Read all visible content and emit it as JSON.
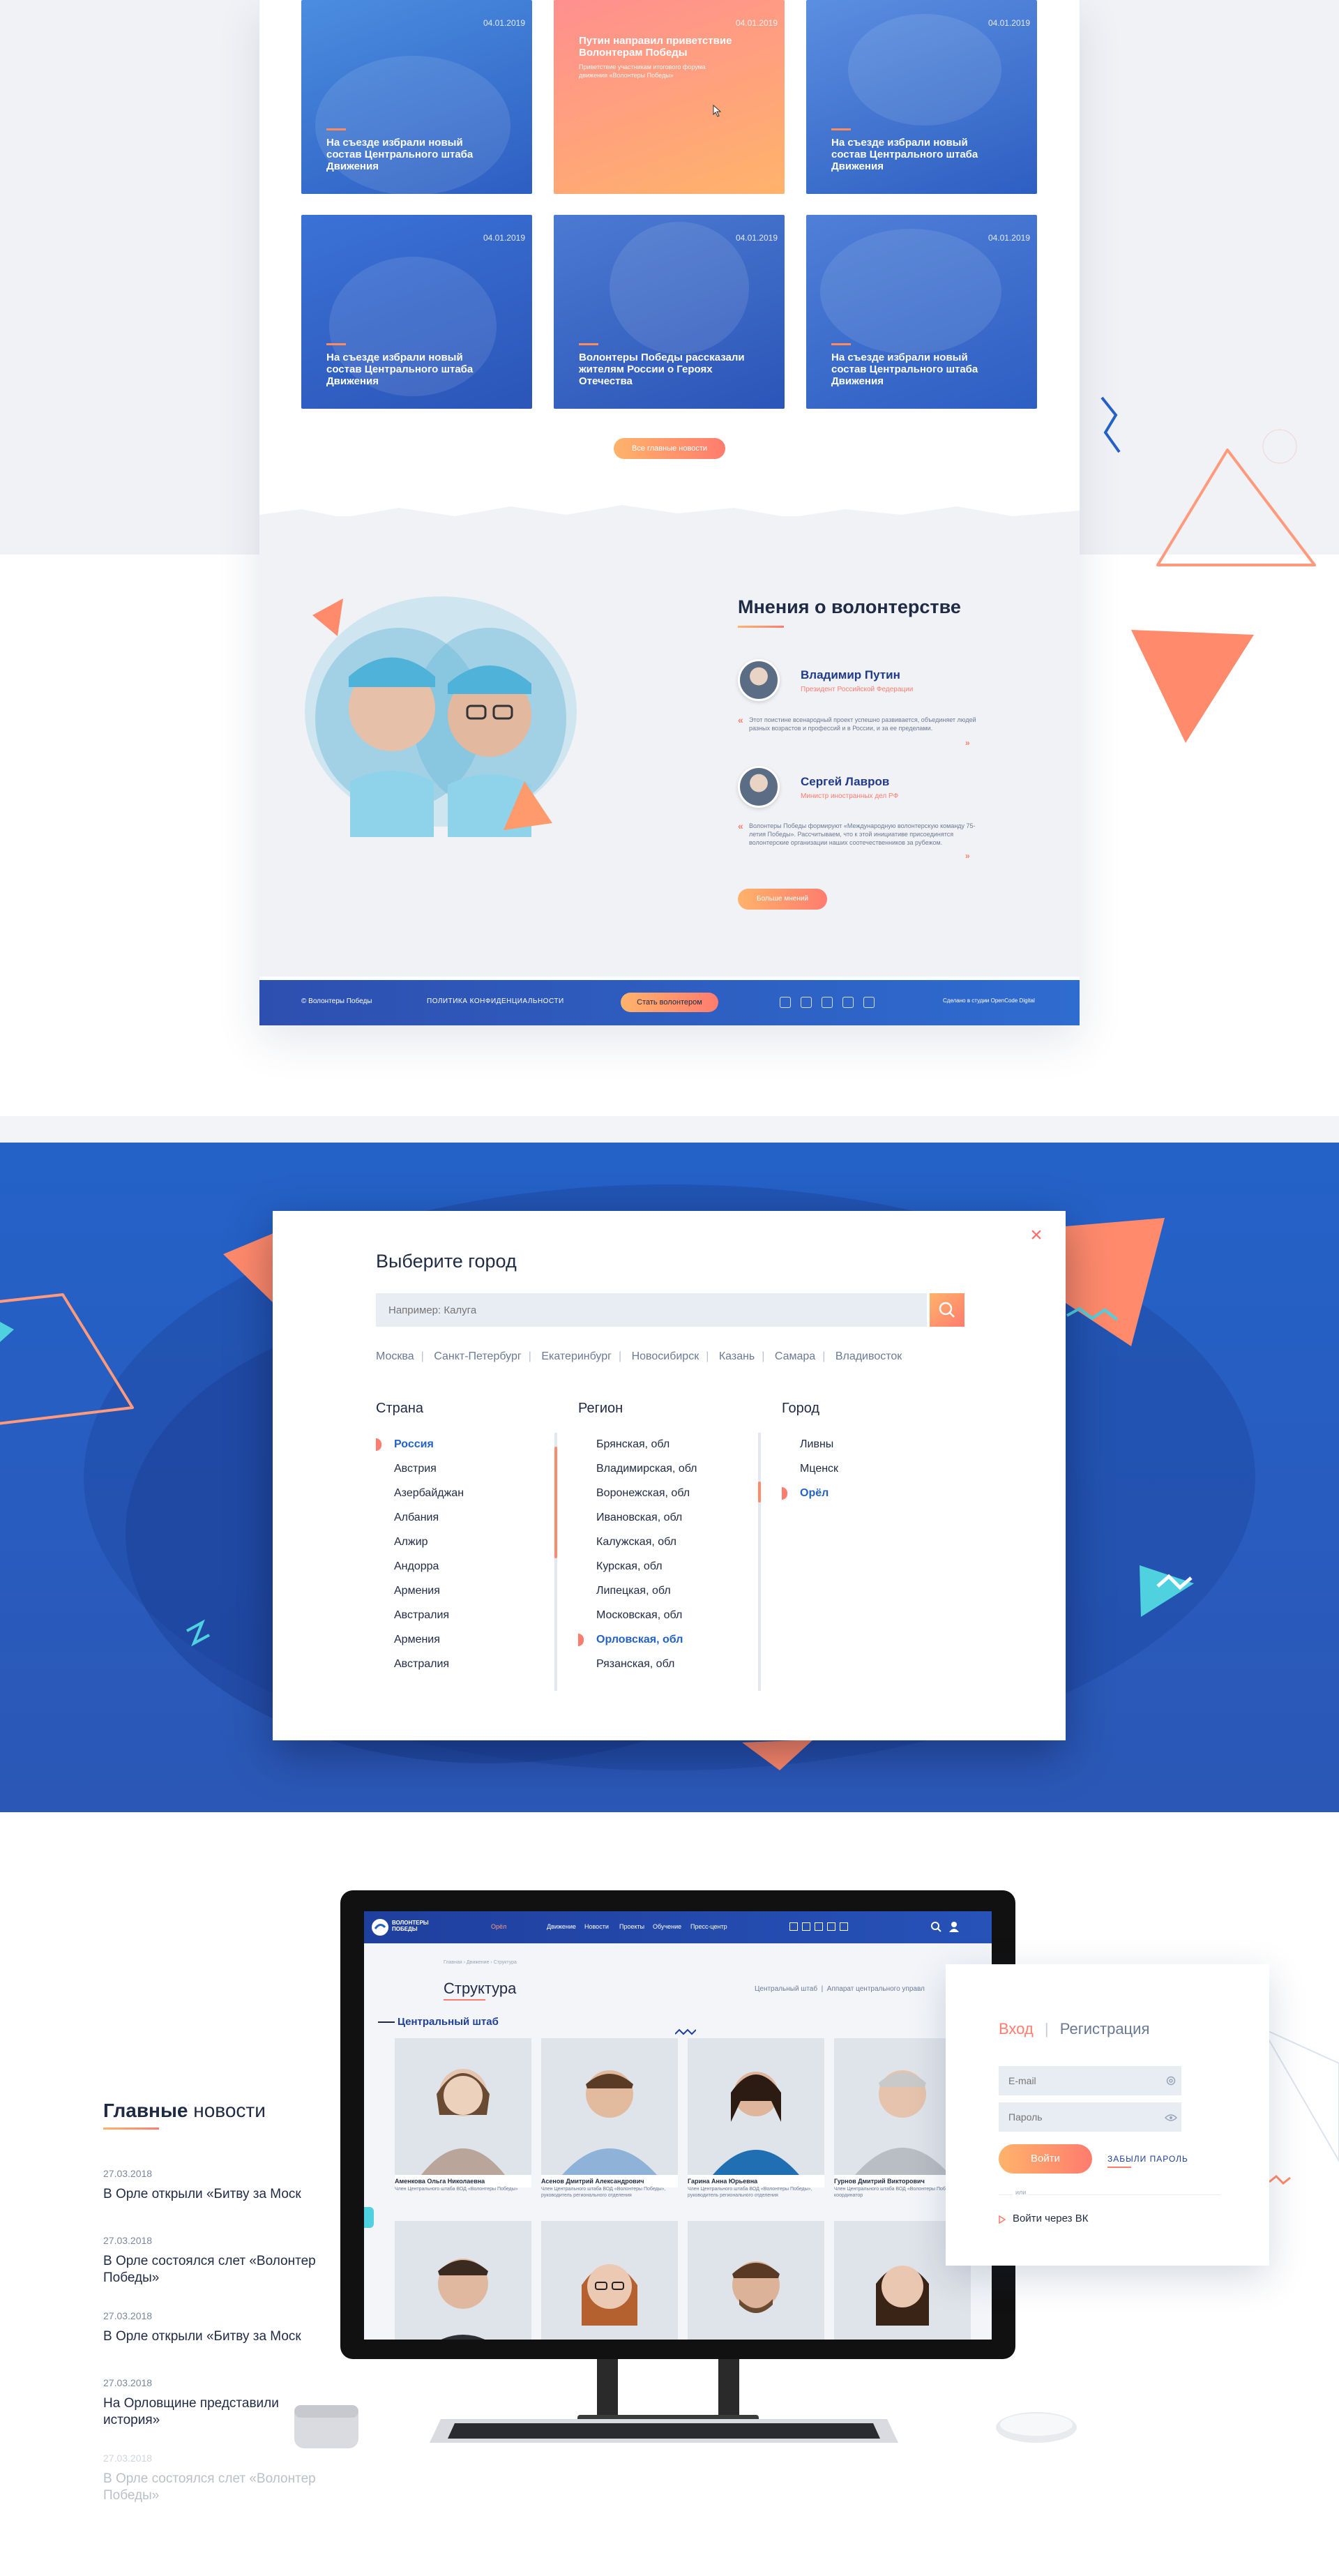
{
  "colors": {
    "accent_orange": "#ff7c6e",
    "accent_peach": "#ffb36b",
    "brand_blue": "#2462c8",
    "dark_text": "#1f2a44"
  },
  "news_cards": [
    {
      "date": "04.01.2019",
      "title": "На съезде избрали новый состав Центрального штаба Движения",
      "text": ""
    },
    {
      "date": "04.01.2019",
      "title": "Путин направил приветствие Волонтерам Победы",
      "text": "Приветствие участникам итогового форума движения «Волонтеры Победы»"
    },
    {
      "date": "04.01.2019",
      "title": "На съезде избрали новый состав Центрального штаба Движения",
      "text": ""
    },
    {
      "date": "04.01.2019",
      "title": "На съезде избрали новый состав Центрального штаба Движения",
      "text": ""
    },
    {
      "date": "04.01.2019",
      "title": "Волонтеры Победы рассказали жителям России о Героях Отечества",
      "text": ""
    },
    {
      "date": "04.01.2019",
      "title": "На съезде избрали новый состав Центрального штаба Движения",
      "text": ""
    }
  ],
  "all_news_label": "Все главные новости",
  "opinions": {
    "title": "Мнения о волонтерстве",
    "items": [
      {
        "name": "Владимир Путин",
        "role": "Президент Российской Федерации",
        "quote": "Этот поистине всенародный проект успешно развивается, объединяет людей разных возрастов и профессий и в России, и за ее пределами."
      },
      {
        "name": "Сергей Лавров",
        "role": "Министр иностранных дел РФ",
        "quote": "Волонтеры Победы формируют «Международную волонтерскую команду 75-летия Победы». Рассчитываем, что к этой инициативе присоединятся волонтерские организации наших соотечественников за рубежом."
      }
    ],
    "more_label": "Больше мнений"
  },
  "footer": {
    "copyright": "© Волонтеры Победы",
    "privacy": "ПОЛИТИКА КОНФИДЕНЦИАЛЬНОСТИ",
    "become_label": "Стать волонтером",
    "made_by": "Сделано в студии OpenCode Digital",
    "social_icons": [
      "vk-icon",
      "youtube-icon",
      "ok-icon",
      "facebook-icon",
      "instagram-icon"
    ]
  },
  "city_modal": {
    "title": "Выберите город",
    "search_placeholder": "Например: Калуга",
    "quick_cities": [
      "Москва",
      "Санкт-Петербург",
      "Екатеринбург",
      "Новосибирск",
      "Казань",
      "Самара",
      "Владивосток"
    ],
    "country_header": "Страна",
    "region_header": "Регион",
    "city_header": "Город",
    "countries": [
      "Россия",
      "Австрия",
      "Азербайджан",
      "Албания",
      "Алжир",
      "Андорра",
      "Армения",
      "Австралия",
      "Армения",
      "Австралия"
    ],
    "selected_country": "Россия",
    "regions": [
      "Брянская, обл",
      "Владимирская, обл",
      "Воронежская, обл",
      "Ивановская, обл",
      "Калужская, обл",
      "Курская, обл",
      "Липецкая, обл",
      "Московская, обл",
      "Орловская, обл",
      "Рязанская, обл"
    ],
    "selected_region": "Орловская, обл",
    "cities": [
      "Ливны",
      "Мценск",
      "Орёл"
    ],
    "selected_city": "Орёл"
  },
  "main_news": {
    "title_bold": "Главные",
    "title_rest": " новости",
    "items": [
      {
        "date": "27.03.2018",
        "title": "В Орле открыли «Битву за Моск"
      },
      {
        "date": "27.03.2018",
        "title": "В Орле состоялся слет «Волонтер Победы»"
      },
      {
        "date": "27.03.2018",
        "title": "В Орле открыли «Битву за Моск"
      },
      {
        "date": "27.03.2018",
        "title": "На Орловщине представили история»"
      },
      {
        "date": "27.03.2018",
        "title": "В Орле состоялся слет «Волонтер Победы»"
      }
    ]
  },
  "monitor_site": {
    "logo_text": "ВОЛОНТЕРЫ ПОБЕДЫ",
    "city": "Орёл",
    "nav": [
      "Движение",
      "Новости",
      "Проекты",
      "Обучение",
      "Пресс-центр"
    ],
    "breadcrumb": "Главная › Движение › Структура",
    "title": "Структура",
    "crumbs_right": "Центральный штаб  |  Аппарат центрального управл",
    "subtitle": "Центральный штаб",
    "people": [
      {
        "name": "Аменкова Ольга Николаевна",
        "role": "Член Центрального штаба ВОД «Волонтеры Победы»"
      },
      {
        "name": "Асенов Дмитрий Александрович",
        "role": "Член Центрального штаба ВОД «Волонтеры Победы», руководитель регионального отделения"
      },
      {
        "name": "Гарина Анна Юрьевна",
        "role": "Член Центрального штаба ВОД «Волонтеры Победы», руководитель регионального отделения"
      },
      {
        "name": "Гурнов Дмитрий Викторович",
        "role": "Член Центрального штаба ВОД «Волонтеры Победы», координатор"
      }
    ]
  },
  "login": {
    "tab_login": "Вход",
    "tab_register": "Регистрация",
    "email_placeholder": "E-mail",
    "password_placeholder": "Пароль",
    "submit_label": "Войти",
    "forgot_label": "ЗАБЫЛИ ПАРОЛЬ",
    "or_label": "или",
    "vk_label": "Войти через ВК"
  }
}
